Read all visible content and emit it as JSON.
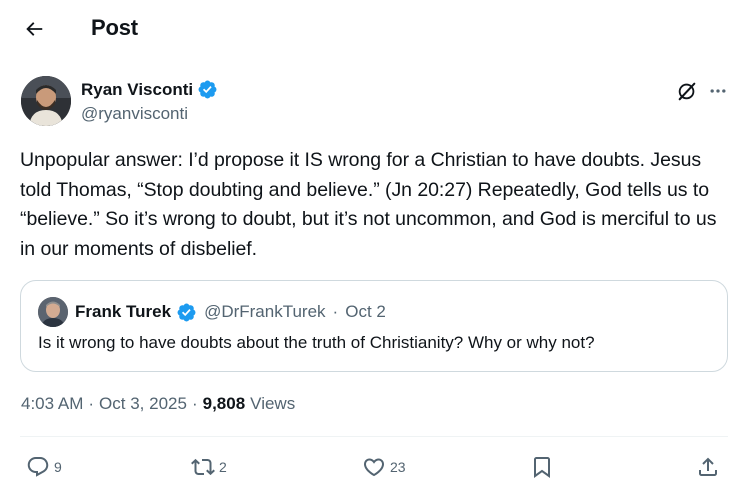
{
  "header": {
    "title": "Post",
    "back_icon": "arrow-left-icon"
  },
  "author": {
    "display_name": "Ryan Visconti",
    "handle": "@ryanvisconti",
    "verified": true,
    "verified_color": "#1d9bf0"
  },
  "tweet": {
    "text": "Unpopular answer: I’d propose it IS wrong for a Christian to have doubts. Jesus told Thomas, “Stop doubting and believe.” (Jn 20:27) Repeatedly, God tells us to “believe.” So it’s wrong to doubt, but it’s not uncommon, and God is merciful to us in our moments of disbelief."
  },
  "quote": {
    "display_name": "Frank Turek",
    "handle": "@DrFrankTurek",
    "separator": "·",
    "date": "Oct 2",
    "text": "Is it wrong to have doubts about the truth of Christianity? Why or why not?",
    "verified": true
  },
  "meta": {
    "time": "4:03 AM",
    "sep1": "·",
    "date": "Oct 3, 2025",
    "sep2": "·",
    "views_count": "9,808",
    "views_label": "Views"
  },
  "actions": {
    "replies": "9",
    "reposts": "2",
    "likes": "23"
  },
  "colors": {
    "text_primary": "#0f1419",
    "text_secondary": "#536471",
    "border": "#cfd9de",
    "accent": "#1d9bf0"
  }
}
